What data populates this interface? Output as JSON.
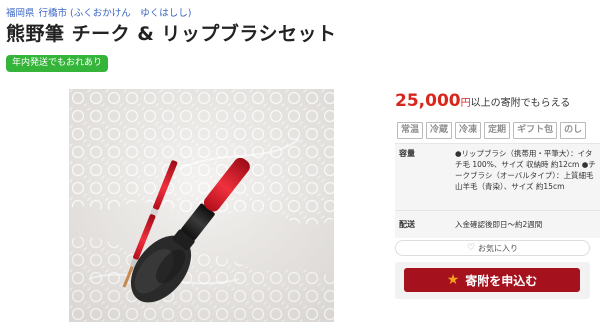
{
  "breadcrumb": {
    "prefecture": "福岡県",
    "city": "行橋市",
    "city_reading": "(ふくおかけん　ゆくはしし)"
  },
  "product": {
    "title": "熊野筆 チーク & リップブラシセット",
    "badge": "年内発送でもおれあり"
  },
  "price": {
    "amount": "25,000",
    "unit": "円",
    "suffix": "以上の寄附でもらえる"
  },
  "tags": [
    "常温",
    "冷蔵",
    "冷凍",
    "定期",
    "ギフト包",
    "のし"
  ],
  "info": {
    "capacity_label": "容量",
    "capacity_value": "●リップブラシ（携帯用・平筆大）：イタチ毛 100%、サイズ 収納時 約12cm ●チークブラシ（オーバルタイプ）：上質細毛山羊毛（青染）、サイズ 約15cm",
    "delivery_label": "配送",
    "delivery_value": "入金確認後即日～約2週間"
  },
  "actions": {
    "favorite_label": "お気に入り",
    "donate_label": "寄附を申込む"
  },
  "colors": {
    "accent_red": "#d9261c",
    "button_red": "#a5111d",
    "badge_green": "#35b43a",
    "link_blue": "#3a66c4"
  },
  "icons": {
    "favorite": "heart-icon",
    "donate": "star-icon"
  }
}
